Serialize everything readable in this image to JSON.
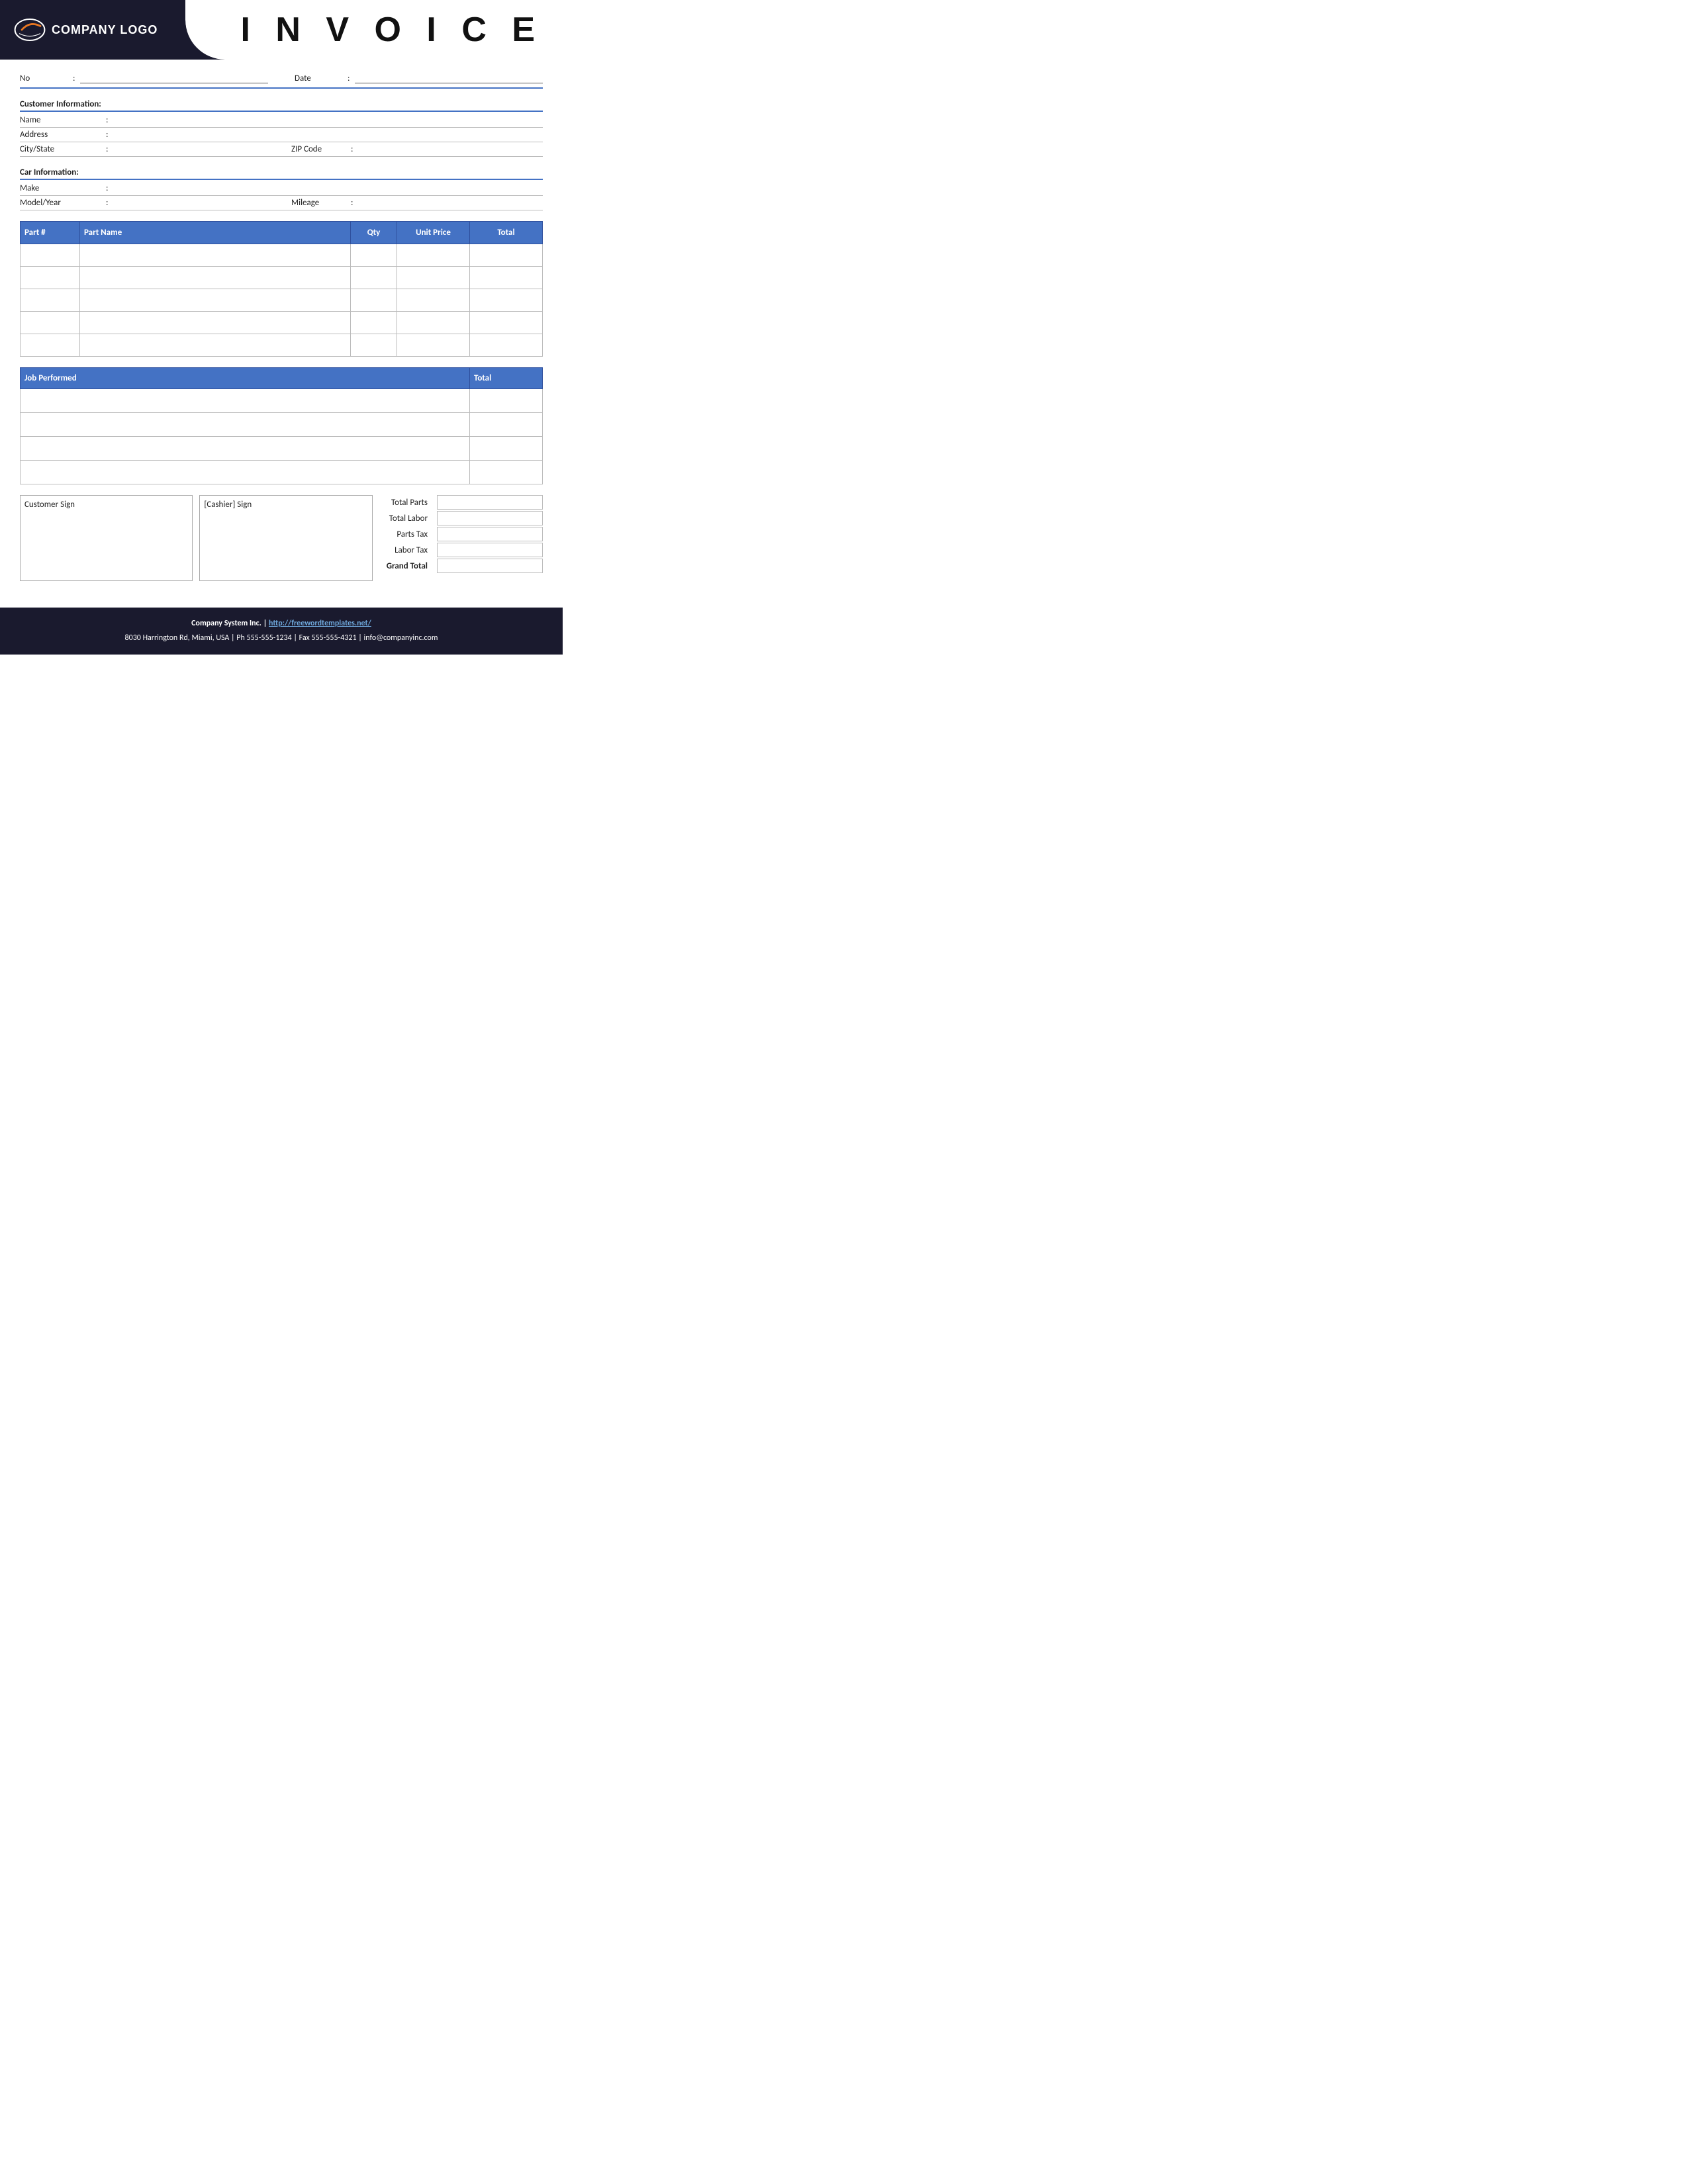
{
  "header": {
    "logo_text": "COMPANY LOGO",
    "title": "I N V O I C E"
  },
  "meta": {
    "no_label": "No",
    "no_colon": ":",
    "date_label": "Date",
    "date_colon": ":"
  },
  "customer_section": {
    "header": "Customer Information:",
    "name_label": "Name",
    "name_colon": ":",
    "address_label": "Address",
    "address_colon": ":",
    "city_state_label": "City/State",
    "city_state_colon": ":",
    "zip_label": "ZIP Code",
    "zip_colon": ":"
  },
  "car_section": {
    "header": "Car Information:",
    "make_label": "Make",
    "make_colon": ":",
    "model_year_label": "Model/Year",
    "model_year_colon": ":",
    "mileage_label": "Mileage",
    "mileage_colon": ":"
  },
  "parts_table": {
    "headers": [
      "Part #",
      "Part Name",
      "Qty",
      "Unit Price",
      "Total"
    ],
    "rows": [
      {
        "part_num": "",
        "part_name": "",
        "qty": "",
        "unit_price": "",
        "total": ""
      },
      {
        "part_num": "",
        "part_name": "",
        "qty": "",
        "unit_price": "",
        "total": ""
      },
      {
        "part_num": "",
        "part_name": "",
        "qty": "",
        "unit_price": "",
        "total": ""
      },
      {
        "part_num": "",
        "part_name": "",
        "qty": "",
        "unit_price": "",
        "total": ""
      },
      {
        "part_num": "",
        "part_name": "",
        "qty": "",
        "unit_price": "",
        "total": ""
      }
    ]
  },
  "job_table": {
    "headers": [
      "Job Performed",
      "Total"
    ],
    "rows": [
      {
        "job": "",
        "total": ""
      },
      {
        "job": "",
        "total": ""
      },
      {
        "job": "",
        "total": ""
      },
      {
        "job": "",
        "total": ""
      }
    ]
  },
  "signatures": {
    "customer_sign": "Customer Sign",
    "cashier_sign": "[Cashier] Sign"
  },
  "totals": {
    "total_parts": "Total Parts",
    "total_labor": "Total Labor",
    "parts_tax": "Parts Tax",
    "labor_tax": "Labor Tax",
    "grand_total": "Grand Total"
  },
  "footer": {
    "company_name": "Company System Inc.",
    "separator": " | ",
    "website": "http://freewordtemplates.net/",
    "address_line": "8030 Harrington Rd, Miami, USA | Ph 555-555-1234 | Fax 555-555-4321 | info@companyinc.com"
  },
  "colors": {
    "header_bg": "#1a1a2e",
    "table_header": "#4472c4",
    "accent": "#4472c4"
  }
}
